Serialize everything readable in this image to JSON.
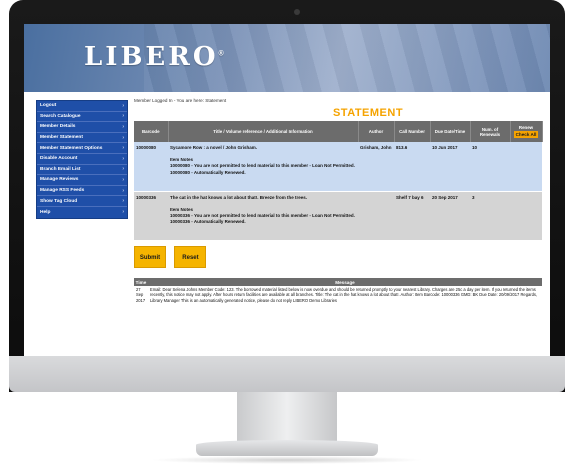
{
  "app": {
    "logo": "LIBERO",
    "logo_mark": "®"
  },
  "sidebar": {
    "items": [
      {
        "label": "Logout"
      },
      {
        "label": "Search Catalogue"
      },
      {
        "label": "Member Details"
      },
      {
        "label": "Member Statement"
      },
      {
        "label": "Member Statement Options"
      },
      {
        "label": "Disable Account"
      },
      {
        "label": "Branch Email List"
      },
      {
        "label": "Manage Reviews"
      },
      {
        "label": "Manage RSS Feeds"
      },
      {
        "label": "Show Tag Cloud"
      },
      {
        "label": "Help"
      }
    ],
    "arrow": "›"
  },
  "main": {
    "breadcrumb": "Member Logged In - You are here: Statement",
    "title": "STATEMENT",
    "table": {
      "headers": {
        "barcode": "Barcode",
        "title": "Title / Volume reference / Additional Information",
        "author": "Author",
        "call_number": "Call Number",
        "due": "Due Date/Time",
        "renewals": "Num. of Renewals",
        "renew": "Renew"
      },
      "check_all": "Check All",
      "rows": [
        {
          "barcode": "10000080",
          "title": "Sycamore Row : a novel / John Grisham.",
          "notes_label": "Item Notes",
          "notes": "10000080 - You are not permitted to lend material to this member - Loan Not Permitted.",
          "renewed": "10000080 - Automatically Renewed.",
          "author": "Grisham, John",
          "call_number": "813.6",
          "due": "10 Jun 2017",
          "renewals": "10"
        },
        {
          "barcode": "10000336",
          "title": "The cat in the hat knows a lot about that!. Breeze from the trees.",
          "notes_label": "Item Notes",
          "notes": "10000336 - You are not permitted to lend material to this member - Loan Not Permitted.",
          "renewed": "10000336 - Automatically Renewed.",
          "author": "",
          "call_number": "Shelf 7 bay 6",
          "due": "20 Sep 2017",
          "renewals": "3"
        }
      ]
    },
    "buttons": {
      "submit": "Submit",
      "reset": "Reset"
    },
    "messages": {
      "headers": {
        "time": "Time",
        "message": "Message"
      },
      "rows": [
        {
          "time": "27 Sep 2017",
          "message": "Email: Dear Selena Johns Member Code: 123. The borrowed material listed below is now overdue and should be returned promptly to your nearest Library. Charges are 25c a day per item. If you returned the items recently, this notice may not apply. After hours return facilities are available at all branches. Title: The cat in the hat knows a lot about that!. Author: Item Barcode: 10000336 GMD: BK Due Date: 20/09/2017 Regards, Library Manager This is an automatically generated notice, please do not reply LIBERO Demo Libraries"
        }
      ]
    }
  },
  "colors": {
    "accent": "#f5a300",
    "sidebar": "#1f4fa8",
    "row1": "#c9daf1",
    "row2": "#d4d4d4",
    "header": "#6c6c6c"
  }
}
